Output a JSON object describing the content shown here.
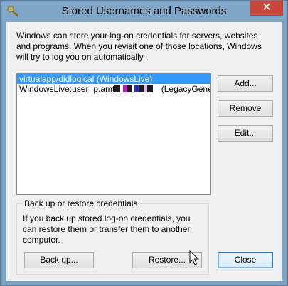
{
  "window": {
    "title": "Stored Usernames and Passwords",
    "close_glyph": "✕"
  },
  "description": "Windows can store your log-on credentials for servers, websites and programs. When you revisit one of those locations, Windows will try to log you on automatically.",
  "credentials": {
    "items": [
      {
        "label": "virtualapp/didlogical (WindowsLive)",
        "selected": true
      },
      {
        "prefix": "WindowsLive:user=p.amt",
        "suffix": " (LegacyGeneric",
        "masked": true,
        "selected": false
      }
    ]
  },
  "buttons": {
    "add": "Add...",
    "remove": "Remove",
    "edit": "Edit...",
    "backup": "Back up...",
    "restore": "Restore...",
    "close": "Close"
  },
  "backup_group": {
    "title": "Back up or restore credentials",
    "text": "If you back up stored log-on credentials, you can restore them or transfer them to another computer."
  },
  "icons": {
    "title_icon": "key-icon",
    "pointer": "mouse-cursor-icon"
  },
  "colors": {
    "selection": "#3399ff",
    "titlebar": "#7fa6c6",
    "close_button": "#c7463a"
  }
}
